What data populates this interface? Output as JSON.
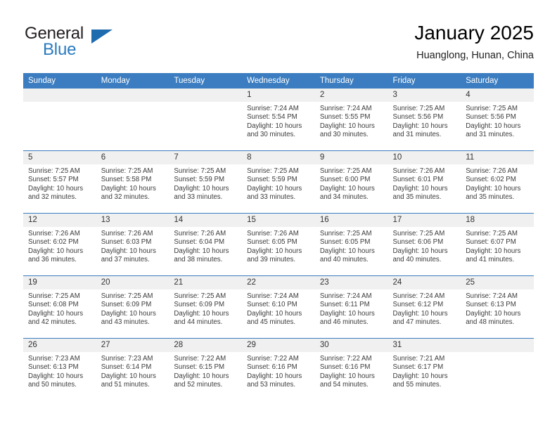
{
  "logo": {
    "word_top": "General",
    "word_bottom": "Blue",
    "accent_color": "#2a7ac0",
    "triangle_color": "#1e6bb0"
  },
  "header": {
    "title": "January 2025",
    "subtitle": "Huanglong, Hunan, China"
  },
  "theme": {
    "header_row_bg": "#3b7dc0",
    "daynum_band_bg": "#f0f0f0",
    "grid_line": "#3b7dc0"
  },
  "weekday_headers": [
    "Sunday",
    "Monday",
    "Tuesday",
    "Wednesday",
    "Thursday",
    "Friday",
    "Saturday"
  ],
  "labels": {
    "sunrise_prefix": "Sunrise:",
    "sunset_prefix": "Sunset:",
    "daylight_prefix": "Daylight:"
  },
  "weeks": [
    [
      {
        "day": "",
        "empty": true
      },
      {
        "day": "",
        "empty": true
      },
      {
        "day": "",
        "empty": true
      },
      {
        "day": "1",
        "sunrise": "Sunrise: 7:24 AM",
        "sunset": "Sunset: 5:54 PM",
        "daylight_1": "Daylight: 10 hours",
        "daylight_2": "and 30 minutes."
      },
      {
        "day": "2",
        "sunrise": "Sunrise: 7:24 AM",
        "sunset": "Sunset: 5:55 PM",
        "daylight_1": "Daylight: 10 hours",
        "daylight_2": "and 30 minutes."
      },
      {
        "day": "3",
        "sunrise": "Sunrise: 7:25 AM",
        "sunset": "Sunset: 5:56 PM",
        "daylight_1": "Daylight: 10 hours",
        "daylight_2": "and 31 minutes."
      },
      {
        "day": "4",
        "sunrise": "Sunrise: 7:25 AM",
        "sunset": "Sunset: 5:56 PM",
        "daylight_1": "Daylight: 10 hours",
        "daylight_2": "and 31 minutes."
      }
    ],
    [
      {
        "day": "5",
        "sunrise": "Sunrise: 7:25 AM",
        "sunset": "Sunset: 5:57 PM",
        "daylight_1": "Daylight: 10 hours",
        "daylight_2": "and 32 minutes."
      },
      {
        "day": "6",
        "sunrise": "Sunrise: 7:25 AM",
        "sunset": "Sunset: 5:58 PM",
        "daylight_1": "Daylight: 10 hours",
        "daylight_2": "and 32 minutes."
      },
      {
        "day": "7",
        "sunrise": "Sunrise: 7:25 AM",
        "sunset": "Sunset: 5:59 PM",
        "daylight_1": "Daylight: 10 hours",
        "daylight_2": "and 33 minutes."
      },
      {
        "day": "8",
        "sunrise": "Sunrise: 7:25 AM",
        "sunset": "Sunset: 5:59 PM",
        "daylight_1": "Daylight: 10 hours",
        "daylight_2": "and 33 minutes."
      },
      {
        "day": "9",
        "sunrise": "Sunrise: 7:25 AM",
        "sunset": "Sunset: 6:00 PM",
        "daylight_1": "Daylight: 10 hours",
        "daylight_2": "and 34 minutes."
      },
      {
        "day": "10",
        "sunrise": "Sunrise: 7:26 AM",
        "sunset": "Sunset: 6:01 PM",
        "daylight_1": "Daylight: 10 hours",
        "daylight_2": "and 35 minutes."
      },
      {
        "day": "11",
        "sunrise": "Sunrise: 7:26 AM",
        "sunset": "Sunset: 6:02 PM",
        "daylight_1": "Daylight: 10 hours",
        "daylight_2": "and 35 minutes."
      }
    ],
    [
      {
        "day": "12",
        "sunrise": "Sunrise: 7:26 AM",
        "sunset": "Sunset: 6:02 PM",
        "daylight_1": "Daylight: 10 hours",
        "daylight_2": "and 36 minutes."
      },
      {
        "day": "13",
        "sunrise": "Sunrise: 7:26 AM",
        "sunset": "Sunset: 6:03 PM",
        "daylight_1": "Daylight: 10 hours",
        "daylight_2": "and 37 minutes."
      },
      {
        "day": "14",
        "sunrise": "Sunrise: 7:26 AM",
        "sunset": "Sunset: 6:04 PM",
        "daylight_1": "Daylight: 10 hours",
        "daylight_2": "and 38 minutes."
      },
      {
        "day": "15",
        "sunrise": "Sunrise: 7:26 AM",
        "sunset": "Sunset: 6:05 PM",
        "daylight_1": "Daylight: 10 hours",
        "daylight_2": "and 39 minutes."
      },
      {
        "day": "16",
        "sunrise": "Sunrise: 7:25 AM",
        "sunset": "Sunset: 6:05 PM",
        "daylight_1": "Daylight: 10 hours",
        "daylight_2": "and 40 minutes."
      },
      {
        "day": "17",
        "sunrise": "Sunrise: 7:25 AM",
        "sunset": "Sunset: 6:06 PM",
        "daylight_1": "Daylight: 10 hours",
        "daylight_2": "and 40 minutes."
      },
      {
        "day": "18",
        "sunrise": "Sunrise: 7:25 AM",
        "sunset": "Sunset: 6:07 PM",
        "daylight_1": "Daylight: 10 hours",
        "daylight_2": "and 41 minutes."
      }
    ],
    [
      {
        "day": "19",
        "sunrise": "Sunrise: 7:25 AM",
        "sunset": "Sunset: 6:08 PM",
        "daylight_1": "Daylight: 10 hours",
        "daylight_2": "and 42 minutes."
      },
      {
        "day": "20",
        "sunrise": "Sunrise: 7:25 AM",
        "sunset": "Sunset: 6:09 PM",
        "daylight_1": "Daylight: 10 hours",
        "daylight_2": "and 43 minutes."
      },
      {
        "day": "21",
        "sunrise": "Sunrise: 7:25 AM",
        "sunset": "Sunset: 6:09 PM",
        "daylight_1": "Daylight: 10 hours",
        "daylight_2": "and 44 minutes."
      },
      {
        "day": "22",
        "sunrise": "Sunrise: 7:24 AM",
        "sunset": "Sunset: 6:10 PM",
        "daylight_1": "Daylight: 10 hours",
        "daylight_2": "and 45 minutes."
      },
      {
        "day": "23",
        "sunrise": "Sunrise: 7:24 AM",
        "sunset": "Sunset: 6:11 PM",
        "daylight_1": "Daylight: 10 hours",
        "daylight_2": "and 46 minutes."
      },
      {
        "day": "24",
        "sunrise": "Sunrise: 7:24 AM",
        "sunset": "Sunset: 6:12 PM",
        "daylight_1": "Daylight: 10 hours",
        "daylight_2": "and 47 minutes."
      },
      {
        "day": "25",
        "sunrise": "Sunrise: 7:24 AM",
        "sunset": "Sunset: 6:13 PM",
        "daylight_1": "Daylight: 10 hours",
        "daylight_2": "and 48 minutes."
      }
    ],
    [
      {
        "day": "26",
        "sunrise": "Sunrise: 7:23 AM",
        "sunset": "Sunset: 6:13 PM",
        "daylight_1": "Daylight: 10 hours",
        "daylight_2": "and 50 minutes."
      },
      {
        "day": "27",
        "sunrise": "Sunrise: 7:23 AM",
        "sunset": "Sunset: 6:14 PM",
        "daylight_1": "Daylight: 10 hours",
        "daylight_2": "and 51 minutes."
      },
      {
        "day": "28",
        "sunrise": "Sunrise: 7:22 AM",
        "sunset": "Sunset: 6:15 PM",
        "daylight_1": "Daylight: 10 hours",
        "daylight_2": "and 52 minutes."
      },
      {
        "day": "29",
        "sunrise": "Sunrise: 7:22 AM",
        "sunset": "Sunset: 6:16 PM",
        "daylight_1": "Daylight: 10 hours",
        "daylight_2": "and 53 minutes."
      },
      {
        "day": "30",
        "sunrise": "Sunrise: 7:22 AM",
        "sunset": "Sunset: 6:16 PM",
        "daylight_1": "Daylight: 10 hours",
        "daylight_2": "and 54 minutes."
      },
      {
        "day": "31",
        "sunrise": "Sunrise: 7:21 AM",
        "sunset": "Sunset: 6:17 PM",
        "daylight_1": "Daylight: 10 hours",
        "daylight_2": "and 55 minutes."
      },
      {
        "day": "",
        "empty": true
      }
    ]
  ]
}
